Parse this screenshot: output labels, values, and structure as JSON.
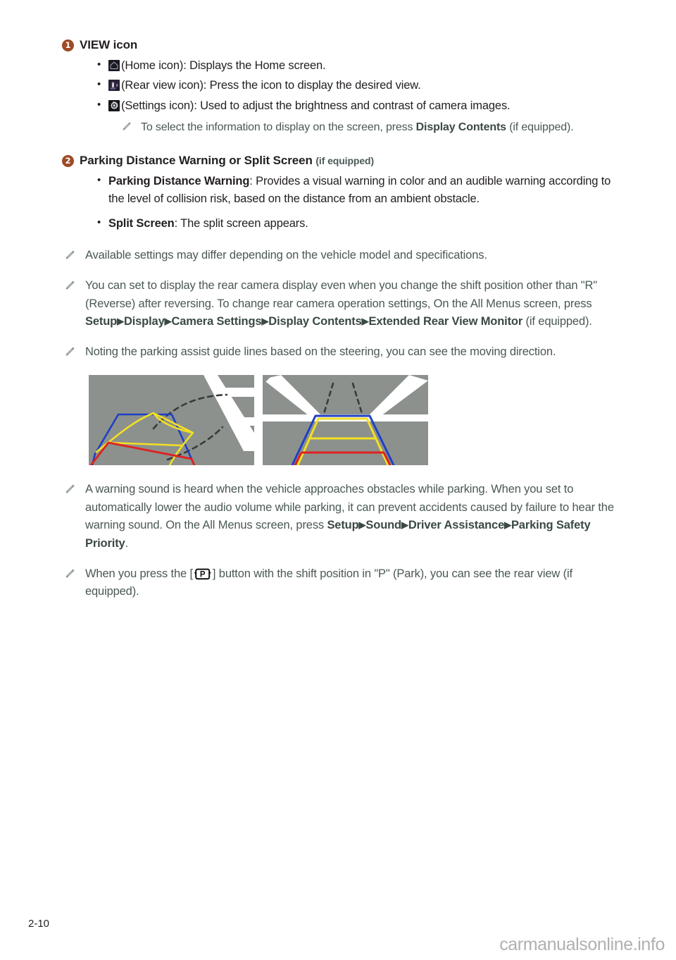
{
  "page": {
    "number": "2-10",
    "watermark": "carmanualsonline.info"
  },
  "sections": [
    {
      "badge": "1",
      "title": "VIEW icon",
      "title_suffix": "",
      "bullets": [
        {
          "icon": "home-icon",
          "bold": "",
          "text": "(Home icon): Displays the Home screen."
        },
        {
          "icon": "rear-view-icon",
          "bold": "",
          "text": "(Rear view icon): Press the icon to display the desired view."
        },
        {
          "icon": "settings-icon",
          "bold": "",
          "text": "(Settings icon): Used to adjust the brightness and contrast of camera images."
        }
      ],
      "subnote": {
        "text_before": "To select the information to display on the screen, press ",
        "bold": "Display Contents",
        "text_after": " (if equipped)."
      }
    },
    {
      "badge": "2",
      "title": "Parking Distance Warning or Split Screen",
      "title_suffix": "(if equipped)",
      "bullets": [
        {
          "icon": "",
          "bold": "Parking Distance Warning",
          "text": ": Provides a visual warning in color and an audible warning according to the level of collision risk, based on the distance from an ambient obstacle."
        },
        {
          "icon": "",
          "bold": "Split Screen",
          "text": ": The split screen appears."
        }
      ]
    }
  ],
  "notes": {
    "note1": "Available settings may differ depending on the vehicle model and specifications.",
    "note2": {
      "part1": "You can set to display the rear camera display even when you change the shift position other than \"R\" (Reverse) after reversing. To change rear camera operation settings, On the All Menus screen, press ",
      "b1": "Setup",
      "sep": "▶",
      "b2": "Display",
      "b3": "Camera Settings",
      "b4": "Display Contents",
      "b5": "Extended Rear View Monitor",
      "part2": " (if equipped)."
    },
    "note3": "Noting the parking assist guide lines based on the steering, you can see the moving direction.",
    "note4": {
      "part1": "A warning sound is heard when the vehicle approaches obstacles while parking. When you set to automatically lower the audio volume while parking, it can prevent accidents caused by failure to hear the warning sound. On the All Menus screen, press ",
      "b1": "Setup",
      "sep": "▶",
      "b2": "Sound",
      "b3": "Driver Assistance",
      "b4": "Parking Safety Priority",
      "part2": "."
    },
    "note5": {
      "part1": "When you press the [",
      "part2": "] button with the shift position in \"P\" (Park), you can see the rear view (if equipped)."
    }
  },
  "figures": {
    "left_alt": "rear-camera-curved-guide-lines",
    "right_alt": "rear-camera-straight-guide-lines",
    "colors": {
      "road": "#8c918d",
      "lane_marking": "#ffffff",
      "blue_guide": "#1f3fc4",
      "yellow_guide": "#f2e024",
      "red_guide": "#e02020",
      "dashed_path": "#3a3a3a"
    }
  },
  "colors": {
    "badge": "#9e4a26",
    "body_text": "#231f20",
    "note_text": "#4a5856",
    "watermark": "#b0b0b0"
  }
}
